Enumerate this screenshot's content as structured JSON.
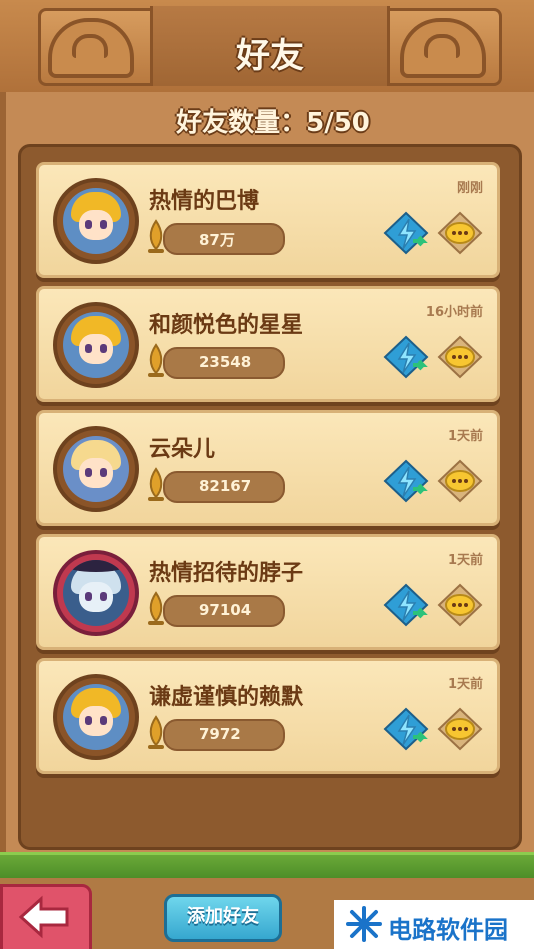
{
  "header": {
    "title": "好友"
  },
  "friends_count": {
    "label": "好友数量：5/50"
  },
  "friends": [
    {
      "name": "热情的巴博",
      "power": "87万",
      "last_seen": "刚刚",
      "avatar_icon": "knight-avatar-icon"
    },
    {
      "name": "和颜悦色的星星",
      "power": "23548",
      "last_seen": "16小时前",
      "avatar_icon": "knight-avatar-icon"
    },
    {
      "name": "云朵儿",
      "power": "82167",
      "last_seen": "1天前",
      "avatar_icon": "maid-avatar-icon"
    },
    {
      "name": "热情招待的脖子",
      "power": "97104",
      "last_seen": "1天前",
      "avatar_icon": "witch-avatar-icon"
    },
    {
      "name": "谦虚谨慎的赖默",
      "power": "7972",
      "last_seen": "1天前",
      "avatar_icon": "knight-avatar-icon"
    }
  ],
  "footer": {
    "add_friend_label": "添加好友",
    "back_icon": "back-arrow-icon",
    "watermark_text": "电路软件园"
  },
  "colors": {
    "card": "#fbe7b9",
    "panel": "#8d5a2e",
    "accent_green": "#2cc27a",
    "accent_blue": "#2f9ed6",
    "chat_yellow": "#f7c631"
  }
}
